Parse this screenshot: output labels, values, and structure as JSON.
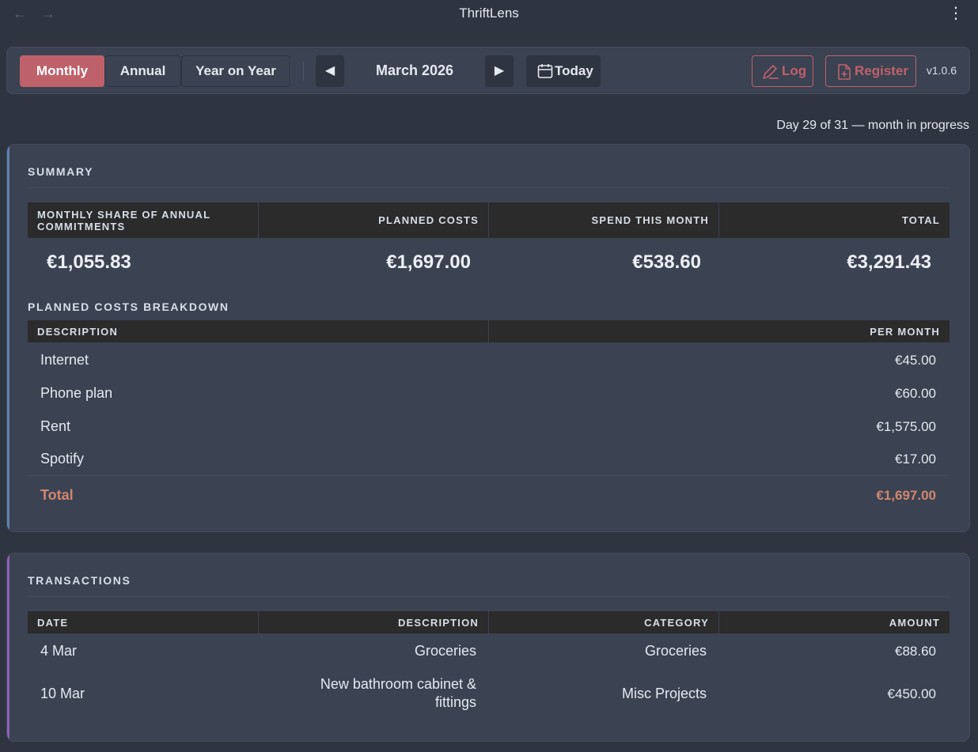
{
  "window": {
    "title": "ThriftLens",
    "back_icon": "arrow-left-icon",
    "forward_icon": "arrow-right-icon",
    "menu_icon": "kebab-menu-icon"
  },
  "toolbar": {
    "views": [
      {
        "label": "Monthly",
        "active": true
      },
      {
        "label": "Annual",
        "active": false
      },
      {
        "label": "Year on Year",
        "active": false
      }
    ],
    "period_label": "March 2026",
    "prev_icon": "triangle-left-icon",
    "next_icon": "triangle-right-icon",
    "today_label": "Today",
    "log_label": "Log",
    "register_label": "Register",
    "version": "v1.0.6"
  },
  "progress_note": "Day 29 of 31 — month in progress",
  "summary": {
    "title": "SUMMARY",
    "columns": [
      "MONTHLY SHARE OF ANNUAL COMMITMENTS",
      "PLANNED COSTS",
      "SPEND THIS MONTH",
      "TOTAL"
    ],
    "values": [
      "€1,055.83",
      "€1,697.00",
      "€538.60",
      "€3,291.43"
    ],
    "breakdown_title": "PLANNED COSTS BREAKDOWN",
    "breakdown_columns": [
      "DESCRIPTION",
      "PER MONTH"
    ],
    "breakdown_rows": [
      {
        "description": "Internet",
        "amount": "€45.00"
      },
      {
        "description": "Phone plan",
        "amount": "€60.00"
      },
      {
        "description": "Rent",
        "amount": "€1,575.00"
      },
      {
        "description": "Spotify",
        "amount": "€17.00"
      }
    ],
    "total_label": "Total",
    "total_amount": "€1,697.00"
  },
  "transactions": {
    "title": "TRANSACTIONS",
    "columns": [
      "DATE",
      "DESCRIPTION",
      "CATEGORY",
      "AMOUNT"
    ],
    "rows": [
      {
        "date": "4 Mar",
        "description": "Groceries",
        "category": "Groceries",
        "amount": "€88.60"
      },
      {
        "date": "10 Mar",
        "description_line1": "New bathroom cabinet &",
        "description_line2": "fittings",
        "category": "Misc Projects",
        "amount": "€450.00"
      }
    ]
  },
  "colors": {
    "accent": "#bf616a",
    "total": "#d08770",
    "summary_stripe": "#5e81ac",
    "transactions_stripe": "#8f5fb3"
  }
}
